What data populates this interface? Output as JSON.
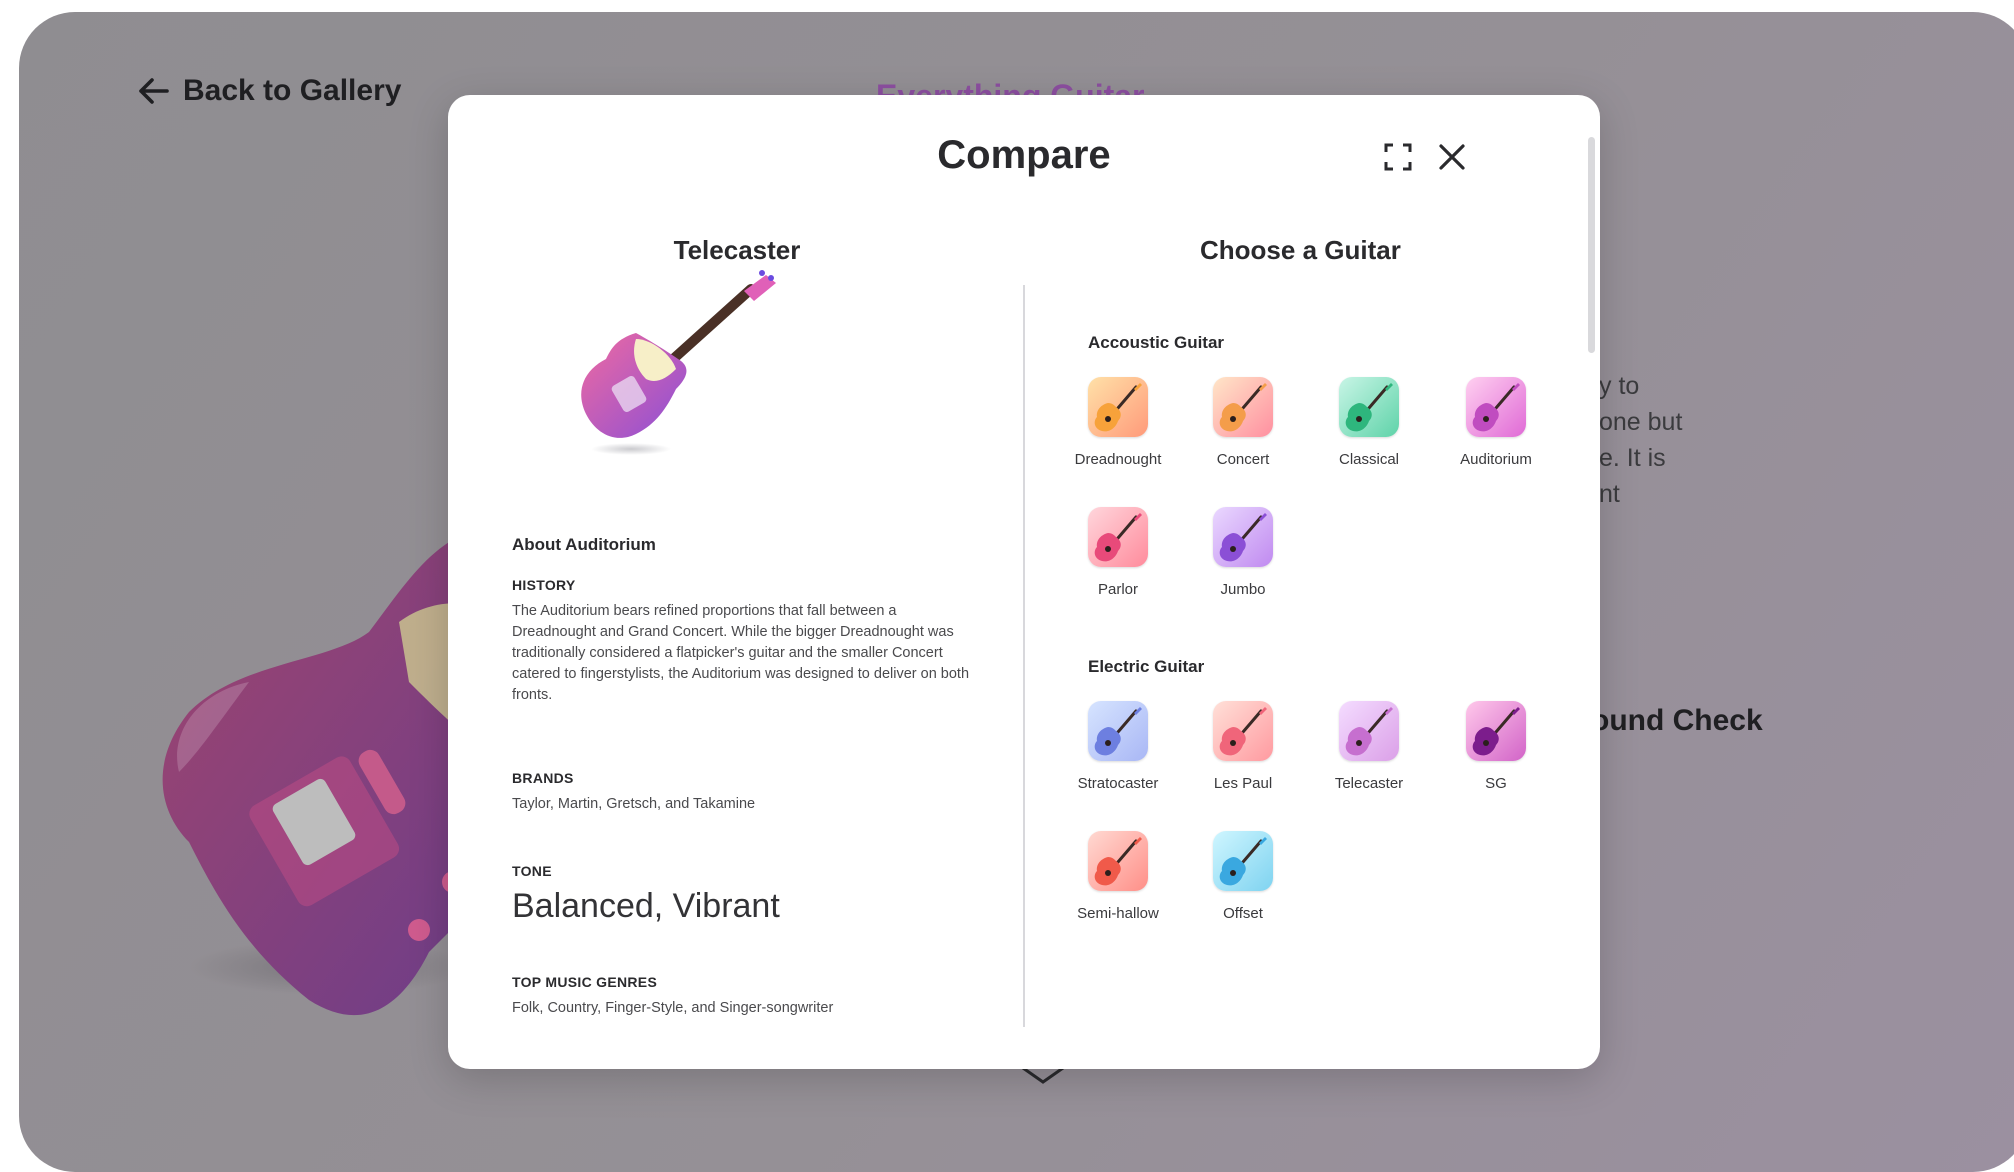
{
  "background": {
    "back_label": "Back to Gallery",
    "title": "Everything Guitar",
    "para_lines": [
      "y to",
      "one but",
      "e. It is",
      "nt"
    ],
    "sound_check": "ound Check"
  },
  "modal": {
    "title": "Compare",
    "left": {
      "heading": "Telecaster",
      "about_title": "About Auditorium",
      "history_label": "HISTORY",
      "history_text": "The Auditorium bears refined proportions that fall between a Dreadnought and Grand Concert. While the bigger Dreadnought was traditionally considered a flatpicker's guitar and the smaller Concert catered to fingerstylists, the Auditorium was designed to deliver on both fronts.",
      "brands_label": "BRANDS",
      "brands_text": "Taylor, Martin, Gretsch, and Takamine",
      "tone_label": "TONE",
      "tone_text": "Balanced, Vibrant",
      "genres_label": "TOP MUSIC GENRES",
      "genres_text": "Folk, Country, Finger-Style, and Singer-songwriter"
    },
    "right": {
      "heading": "Choose a Guitar",
      "acoustic": {
        "title": "Accoustic Guitar",
        "items": [
          {
            "label": "Dreadnought",
            "from": "#ffe1a8",
            "to": "#ff9a7a",
            "body": "#f7a23a"
          },
          {
            "label": "Concert",
            "from": "#ffe6c8",
            "to": "#ff8fa0",
            "body": "#f49d4a"
          },
          {
            "label": "Classical",
            "from": "#c8f5e6",
            "to": "#5fd3a9",
            "body": "#2eb67d"
          },
          {
            "label": "Auditorium",
            "from": "#ffd0f0",
            "to": "#e06ad6",
            "body": "#c04cc0"
          },
          {
            "label": "Parlor",
            "from": "#ffd6dc",
            "to": "#ff8b9c",
            "body": "#e84a7a"
          },
          {
            "label": "Jumbo",
            "from": "#ead8ff",
            "to": "#c08af0",
            "body": "#8b4fd6"
          }
        ]
      },
      "electric": {
        "title": "Electric Guitar",
        "items": [
          {
            "label": "Stratocaster",
            "from": "#d6e4ff",
            "to": "#a9b7f5",
            "body": "#6d7fe0"
          },
          {
            "label": "Les Paul",
            "from": "#ffe0d8",
            "to": "#ff9aa0",
            "body": "#f0657a"
          },
          {
            "label": "Telecaster",
            "from": "#f4dcff",
            "to": "#dba0e8",
            "body": "#c66fcf"
          },
          {
            "label": "SG",
            "from": "#ffc8ea",
            "to": "#d264c8",
            "body": "#7c1d8c"
          },
          {
            "label": "Semi-hallow",
            "from": "#ffd9d2",
            "to": "#ff8f88",
            "body": "#f05a4a"
          },
          {
            "label": "Offset",
            "from": "#cff6ff",
            "to": "#7fd3f0",
            "body": "#3aa8e0"
          }
        ]
      }
    }
  }
}
